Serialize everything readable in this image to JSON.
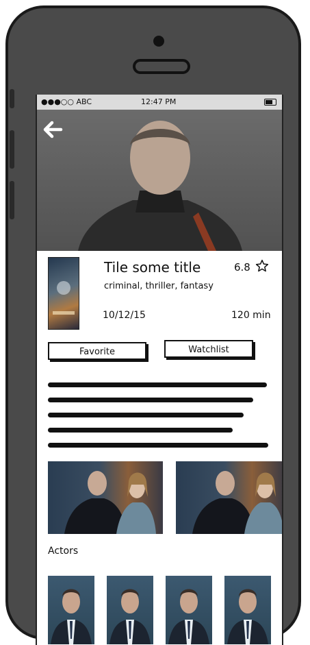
{
  "status_bar": {
    "carrier": "●●●○○ ABC",
    "time": "12:47 PM"
  },
  "movie": {
    "title": "Tile some title",
    "rating": "6.8",
    "genres": "criminal, thriller, fantasy",
    "release_date": "10/12/15",
    "runtime": "120 min"
  },
  "actions": {
    "favorite_label": "Favorite",
    "watchlist_label": "Watchlist"
  },
  "sections": {
    "actors_label": "Actors"
  },
  "icons": {
    "back": "arrow-left-icon",
    "rating": "star-outline-icon",
    "battery": "battery-icon"
  },
  "colors": {
    "phone_body": "#4a4a4a",
    "outline": "#111111",
    "status_bar": "#dcdcdc"
  }
}
